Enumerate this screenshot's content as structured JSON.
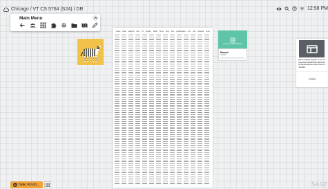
{
  "topbar": {
    "location": "Chicago / VT CS 5764 (S24) / DR",
    "time": "12:58 PM",
    "icons": [
      "cloud-icon",
      "eye-icon",
      "search-icon",
      "help-icon",
      "wifi-icon"
    ]
  },
  "main_menu": {
    "title": "Main Menu",
    "icons": [
      "back-arrow-icon",
      "users-icon",
      "apps-grid-icon",
      "puzzle-icon",
      "settings-icon",
      "folder-icon",
      "map-icon",
      "pencil-icon"
    ]
  },
  "document": {
    "header_columns": [
      "Tweet",
      "Date",
      "Heights",
      "Hits",
      "Tic",
      "Height",
      "Skills",
      "Tours",
      "Size",
      "Fus",
      "Qualification",
      "Ext",
      "Sint",
      "Awards",
      "Gust"
    ]
  },
  "cards": {
    "teal_label": "Create new SAGE3 board",
    "board_title": "Board",
    "board_subtitle": "Untitled",
    "web_url": "https://sage3.bhptac-vt.cs.edu/api/files/39495206-d0b9-4691-8ea3-a4baee-a4d7de13-9-5fc94d",
    "note_text": "Untitled"
  },
  "bottombar": {
    "user_label": "Naki Kirsin...",
    "user_initial": "N",
    "logo_text": "SAGE"
  },
  "colors": {
    "menu_bg": "#ffffff",
    "zebra_bg": "#f2c14a",
    "teal": "#5fc5a8",
    "user_btn": "#f2a43a"
  }
}
